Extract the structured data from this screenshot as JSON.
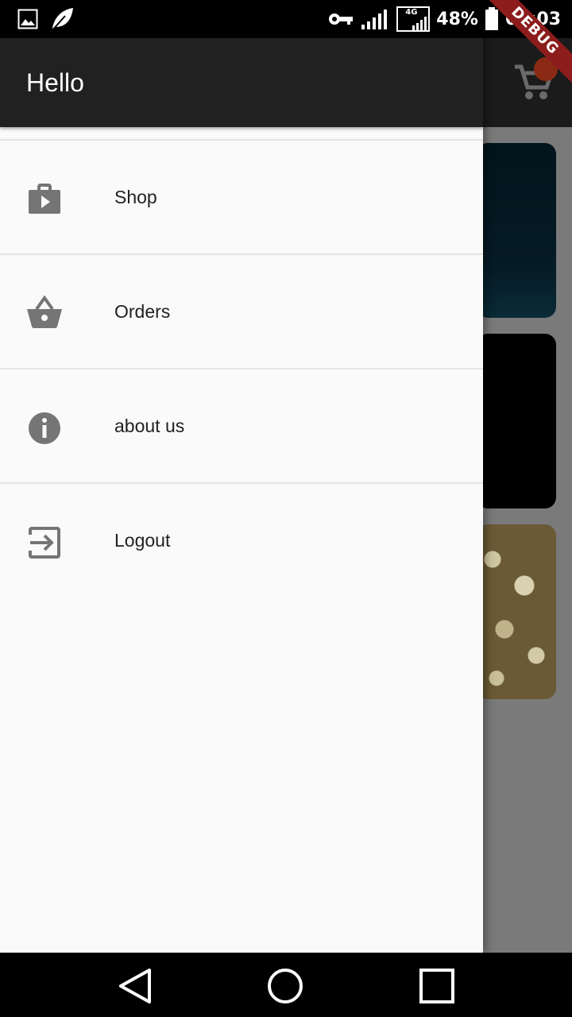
{
  "status_bar": {
    "battery": "48%",
    "time": "09:03",
    "network": "4G",
    "icons": [
      "image-icon",
      "leaf-icon",
      "vpn-key-icon",
      "signal-icon",
      "battery-icon"
    ]
  },
  "debug_banner": "DEBUG",
  "drawer": {
    "title": "Hello",
    "items": [
      {
        "label": "Shop",
        "icon": "shop-icon"
      },
      {
        "label": "Orders",
        "icon": "basket-icon"
      },
      {
        "label": "about us",
        "icon": "info-icon"
      },
      {
        "label": "Logout",
        "icon": "exit-icon"
      }
    ]
  },
  "colors": {
    "drawer_header": "#212121",
    "drawer_bg": "#fafafa",
    "icon": "#757575",
    "debug_ribbon": "#8d1c1c"
  }
}
